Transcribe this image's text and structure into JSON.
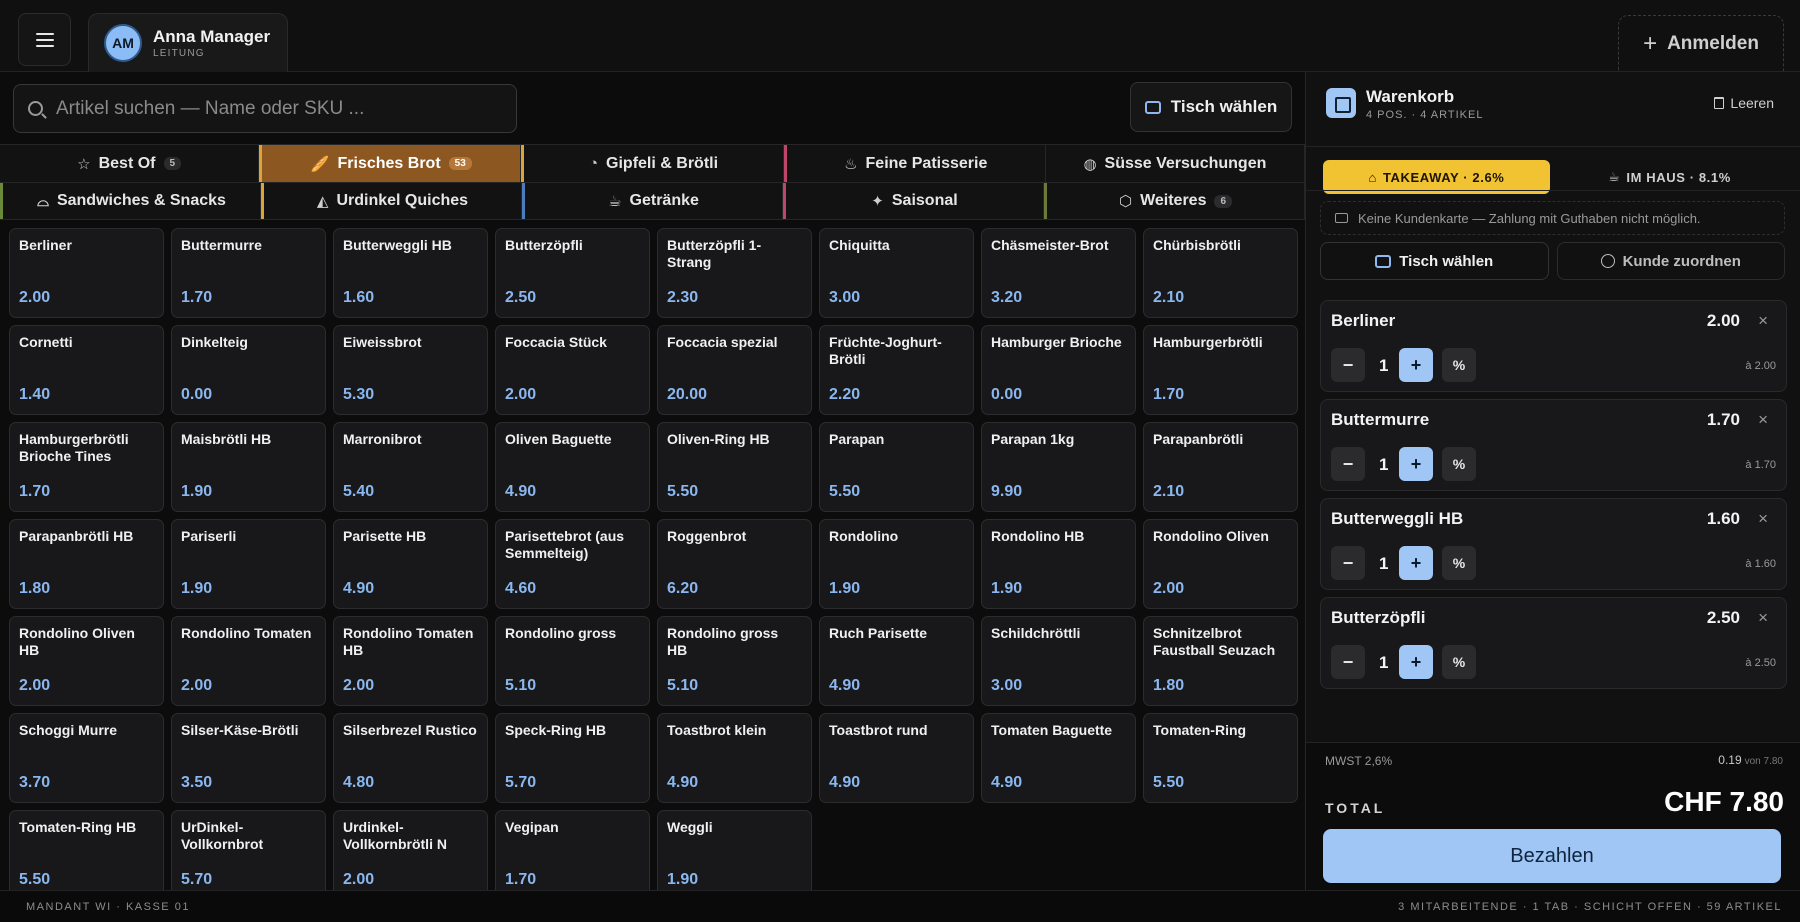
{
  "user": {
    "initials": "AM",
    "name": "Anna Manager",
    "role": "LEITUNG"
  },
  "header": {
    "login_label": "Anmelden"
  },
  "search": {
    "placeholder": "Artikel suchen — Name oder SKU ..."
  },
  "table_button": "Tisch wählen",
  "categories_row1": [
    {
      "label": "Best Of",
      "badge": "5",
      "icon": "star-icon"
    },
    {
      "label": "Frisches Brot",
      "badge": "53",
      "icon": "bread-icon",
      "active": true
    },
    {
      "label": "Gipfeli & Brötli",
      "badge": "",
      "icon": "croissant-icon"
    },
    {
      "label": "Feine Patisserie",
      "badge": "",
      "icon": "cake-icon"
    },
    {
      "label": "Süsse Versuchungen",
      "badge": "",
      "icon": "cookie-icon"
    }
  ],
  "categories_row2": [
    {
      "label": "Sandwiches & Snacks",
      "badge": "",
      "icon": "sandwich-icon"
    },
    {
      "label": "Urdinkel Quiches",
      "badge": "",
      "icon": "pizza-icon"
    },
    {
      "label": "Getränke",
      "badge": "",
      "icon": "coffee-icon"
    },
    {
      "label": "Saisonal",
      "badge": "",
      "icon": "sparkles-icon"
    },
    {
      "label": "Weiteres",
      "badge": "6",
      "icon": "box-icon"
    }
  ],
  "category_colors": {
    "active": "#8d5722",
    "accent_gold": "#d9a53a",
    "accent_pink": "#c0456a",
    "accent_green": "#6b8a3a",
    "accent_blue": "#4a7cc0"
  },
  "products": [
    {
      "name": "Berliner",
      "price": "2.00"
    },
    {
      "name": "Buttermurre",
      "price": "1.70"
    },
    {
      "name": "Butterweggli HB",
      "price": "1.60"
    },
    {
      "name": "Butterzöpfli",
      "price": "2.50"
    },
    {
      "name": "Butterzöpfli 1-Strang",
      "price": "2.30"
    },
    {
      "name": "Chiquitta",
      "price": "3.00"
    },
    {
      "name": "Chäsmeister-Brot",
      "price": "3.20"
    },
    {
      "name": "Chürbisbrötli",
      "price": "2.10"
    },
    {
      "name": "Cornetti",
      "price": "1.40"
    },
    {
      "name": "Dinkelteig",
      "price": "0.00"
    },
    {
      "name": "Eiweissbrot",
      "price": "5.30"
    },
    {
      "name": "Foccacia Stück",
      "price": "2.00"
    },
    {
      "name": "Foccacia spezial",
      "price": "20.00"
    },
    {
      "name": "Früchte-Joghurt-Brötli",
      "price": "2.20"
    },
    {
      "name": "Hamburger Brioche",
      "price": "0.00"
    },
    {
      "name": "Hamburgerbrötli",
      "price": "1.70"
    },
    {
      "name": "Hamburgerbrötli Brioche Tines",
      "price": "1.70"
    },
    {
      "name": "Maisbrötli HB",
      "price": "1.90"
    },
    {
      "name": "Marronibrot",
      "price": "5.40"
    },
    {
      "name": "Oliven Baguette",
      "price": "4.90"
    },
    {
      "name": "Oliven-Ring HB",
      "price": "5.50"
    },
    {
      "name": "Parapan",
      "price": "5.50"
    },
    {
      "name": "Parapan 1kg",
      "price": "9.90"
    },
    {
      "name": "Parapanbrötli",
      "price": "2.10"
    },
    {
      "name": "Parapanbrötli HB",
      "price": "1.80"
    },
    {
      "name": "Pariserli",
      "price": "1.90"
    },
    {
      "name": "Parisette HB",
      "price": "4.90"
    },
    {
      "name": "Parisettebrot (aus Semmelteig)",
      "price": "4.60"
    },
    {
      "name": "Roggenbrot",
      "price": "6.20"
    },
    {
      "name": "Rondolino",
      "price": "1.90"
    },
    {
      "name": "Rondolino HB",
      "price": "1.90"
    },
    {
      "name": "Rondolino Oliven",
      "price": "2.00"
    },
    {
      "name": "Rondolino Oliven HB",
      "price": "2.00"
    },
    {
      "name": "Rondolino Tomaten",
      "price": "2.00"
    },
    {
      "name": "Rondolino Tomaten HB",
      "price": "2.00"
    },
    {
      "name": "Rondolino gross",
      "price": "5.10"
    },
    {
      "name": "Rondolino gross HB",
      "price": "5.10"
    },
    {
      "name": "Ruch Parisette",
      "price": "4.90"
    },
    {
      "name": "Schildchröttli",
      "price": "3.00"
    },
    {
      "name": "Schnitzelbrot Faustball Seuzach",
      "price": "1.80"
    },
    {
      "name": "Schoggi Murre",
      "price": "3.70"
    },
    {
      "name": "Silser-Käse-Brötli",
      "price": "3.50"
    },
    {
      "name": "Silserbrezel Rustico",
      "price": "4.80"
    },
    {
      "name": "Speck-Ring HB",
      "price": "5.70"
    },
    {
      "name": "Toastbrot klein",
      "price": "4.90"
    },
    {
      "name": "Toastbrot rund",
      "price": "4.90"
    },
    {
      "name": "Tomaten Baguette",
      "price": "4.90"
    },
    {
      "name": "Tomaten-Ring",
      "price": "5.50"
    },
    {
      "name": "Tomaten-Ring HB",
      "price": "5.50"
    },
    {
      "name": "UrDinkel-Vollkornbrot",
      "price": "5.70"
    },
    {
      "name": "Urdinkel-Vollkornbrötli N",
      "price": "2.00"
    },
    {
      "name": "Vegipan",
      "price": "1.70"
    },
    {
      "name": "Weggli",
      "price": "1.90"
    }
  ],
  "cart": {
    "title": "Warenkorb",
    "subtitle": "4 POS. · 4 ARTIKEL",
    "clear_label": "Leeren",
    "mode_takeaway": "TAKEAWAY · 2.6%",
    "mode_inhouse": "IM HAUS · 8.1%",
    "notice": "Keine Kundenkarte — Zahlung mit Guthaben nicht möglich.",
    "table_label": "Tisch wählen",
    "customer_label": "Kunde zuordnen",
    "items": [
      {
        "name": "Berliner",
        "price": "2.00",
        "qty": "1",
        "unit": "à 2.00"
      },
      {
        "name": "Buttermurre",
        "price": "1.70",
        "qty": "1",
        "unit": "à 1.70"
      },
      {
        "name": "Butterweggli HB",
        "price": "1.60",
        "qty": "1",
        "unit": "à 1.60"
      },
      {
        "name": "Butterzöpfli",
        "price": "2.50",
        "qty": "1",
        "unit": "à 2.50"
      }
    ],
    "vat_label": "MWST 2,6%",
    "vat_value": "0.19",
    "vat_of": "von 7.80",
    "total_label": "TOTAL",
    "total_value": "CHF 7.80",
    "pay_label": "Bezahlen"
  },
  "footer": {
    "left": "MANDANT WI · KASSE 01",
    "right": "3 MITARBEITENDE · 1 TAB · SCHICHT OFFEN · 59 ARTIKEL"
  }
}
